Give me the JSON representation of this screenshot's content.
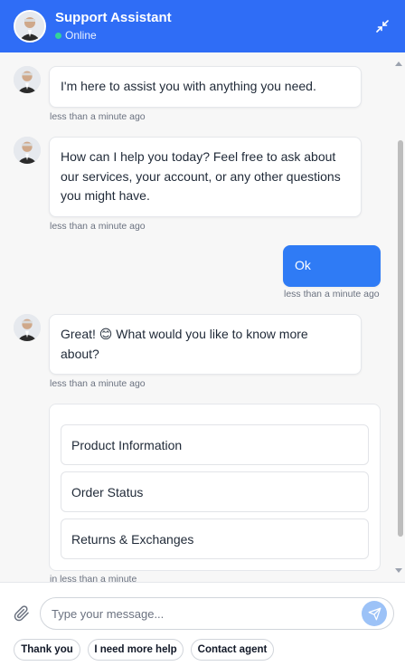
{
  "header": {
    "title": "Support Assistant",
    "status": "Online",
    "status_color": "#34d399",
    "background": "#2f6df6",
    "minimize_icon": "minimize-icon"
  },
  "messages": [
    {
      "sender": "assistant",
      "text": "I'm here to assist you with anything you need.",
      "time": "less than a minute ago"
    },
    {
      "sender": "assistant",
      "text": "How can I help you today? Feel free to ask about our services, your account, or any other questions you might have.",
      "time": "less than a minute ago"
    },
    {
      "sender": "user",
      "text": "Ok",
      "time": "less than a minute ago"
    },
    {
      "sender": "assistant",
      "text": "Great! 😊 What would you like to know more about?",
      "time": "less than a minute ago"
    }
  ],
  "options": {
    "items": [
      "Product Information",
      "Order Status",
      "Returns & Exchanges"
    ],
    "time": "in less than a minute"
  },
  "composer": {
    "placeholder": "Type your message...",
    "value": "",
    "attach_icon": "paperclip-icon",
    "send_icon": "send-icon"
  },
  "quick_replies": [
    "Thank you",
    "I need more help",
    "Contact agent"
  ],
  "colors": {
    "user_bubble": "#2f7bf5",
    "send_button": "#9cc2f7"
  }
}
